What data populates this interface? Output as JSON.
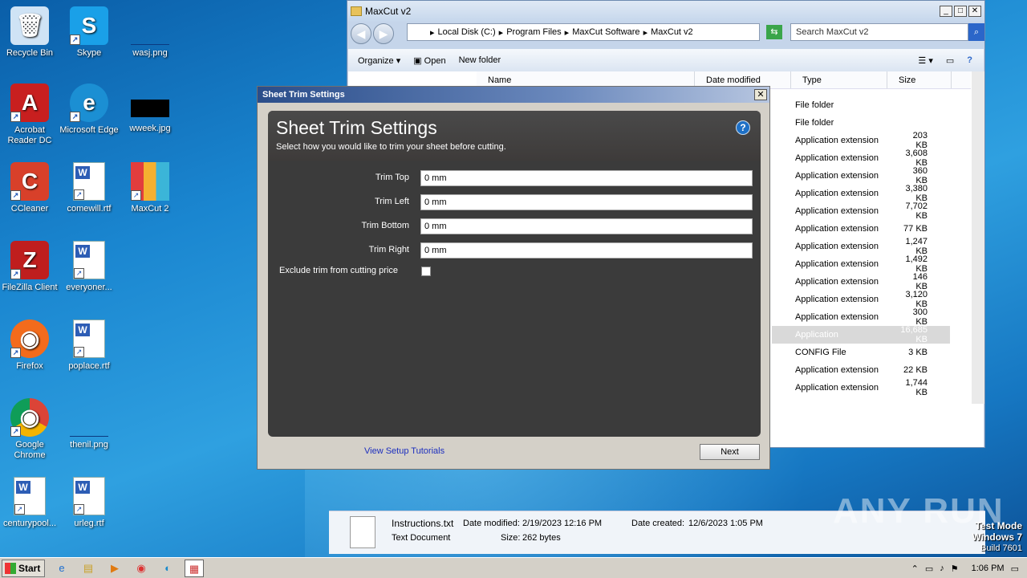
{
  "desktop": {
    "icons": [
      {
        "label": "Recycle Bin",
        "icon": "recycle-bin-icon"
      },
      {
        "label": "Skype",
        "icon": "skype-icon"
      },
      {
        "label": "wasj.png",
        "icon": "image-file-icon"
      },
      {
        "label": "Acrobat Reader DC",
        "icon": "acrobat-icon"
      },
      {
        "label": "Microsoft Edge",
        "icon": "edge-icon"
      },
      {
        "label": "wweek.jpg",
        "icon": "image-file-icon"
      },
      {
        "label": "CCleaner",
        "icon": "ccleaner-icon"
      },
      {
        "label": "comewill.rtf",
        "icon": "word-doc-icon"
      },
      {
        "label": "MaxCut 2",
        "icon": "maxcut-icon"
      },
      {
        "label": "FileZilla Client",
        "icon": "filezilla-icon"
      },
      {
        "label": "everyoner...",
        "icon": "word-doc-icon"
      },
      {
        "label": "Firefox",
        "icon": "firefox-icon"
      },
      {
        "label": "poplace.rtf",
        "icon": "word-doc-icon"
      },
      {
        "label": "Google Chrome",
        "icon": "chrome-icon"
      },
      {
        "label": "thenil.png",
        "icon": "image-file-icon"
      },
      {
        "label": "centurypool...",
        "icon": "word-doc-icon"
      },
      {
        "label": "urleg.rtf",
        "icon": "word-doc-icon"
      }
    ]
  },
  "explorer": {
    "title": "MaxCut v2",
    "breadcrumbs": [
      "Local Disk (C:)",
      "Program Files",
      "MaxCut Software",
      "MaxCut v2"
    ],
    "search_placeholder": "Search MaxCut v2",
    "toolbar": {
      "organize": "Organize",
      "open": "Open",
      "new_folder": "New folder"
    },
    "columns": [
      "Name",
      "Date modified",
      "Type",
      "Size"
    ],
    "rows": [
      {
        "type": "File folder",
        "size": ""
      },
      {
        "type": "File folder",
        "size": ""
      },
      {
        "type": "Application extension",
        "size": "203 KB"
      },
      {
        "type": "Application extension",
        "size": "3,608 KB"
      },
      {
        "type": "Application extension",
        "size": "360 KB"
      },
      {
        "type": "Application extension",
        "size": "3,380 KB"
      },
      {
        "type": "Application extension",
        "size": "7,702 KB"
      },
      {
        "type": "Application extension",
        "size": "77 KB"
      },
      {
        "type": "Application extension",
        "size": "1,247 KB"
      },
      {
        "type": "Application extension",
        "size": "1,492 KB"
      },
      {
        "type": "Application extension",
        "size": "146 KB"
      },
      {
        "type": "Application extension",
        "size": "3,120 KB"
      },
      {
        "type": "Application extension",
        "size": "300 KB"
      },
      {
        "type": "Application",
        "size": "16,685 KB"
      },
      {
        "type": "CONFIG File",
        "size": "3 KB"
      },
      {
        "type": "Application extension",
        "size": "22 KB"
      },
      {
        "type": "Application extension",
        "size": "1,744 KB"
      }
    ],
    "details": {
      "name": "Instructions.txt",
      "kind": "Text Document",
      "modified_label": "Date modified:",
      "modified": "2/19/2023 12:16 PM",
      "created_label": "Date created:",
      "created": "12/6/2023 1:05 PM",
      "size_label": "Size:",
      "size": "262 bytes"
    }
  },
  "dialog": {
    "window_title": "Sheet Trim Settings",
    "heading": "Sheet Trim Settings",
    "subheading": "Select how you would like to trim your sheet before cutting.",
    "fields": [
      {
        "label": "Trim Top",
        "value": "0 mm"
      },
      {
        "label": "Trim Left",
        "value": "0 mm"
      },
      {
        "label": "Trim Bottom",
        "value": "0 mm"
      },
      {
        "label": "Trim Right",
        "value": "0 mm"
      }
    ],
    "exclude_label": "Exclude trim from cutting price",
    "exclude_checked": false,
    "link": "View Setup Tutorials",
    "next": "Next"
  },
  "taskbar": {
    "start": "Start",
    "time": "1:06 PM"
  },
  "watermark": {
    "line1": "Test Mode",
    "line2": "Windows 7",
    "line3": "Build 7601",
    "brand": "ANY RUN"
  }
}
